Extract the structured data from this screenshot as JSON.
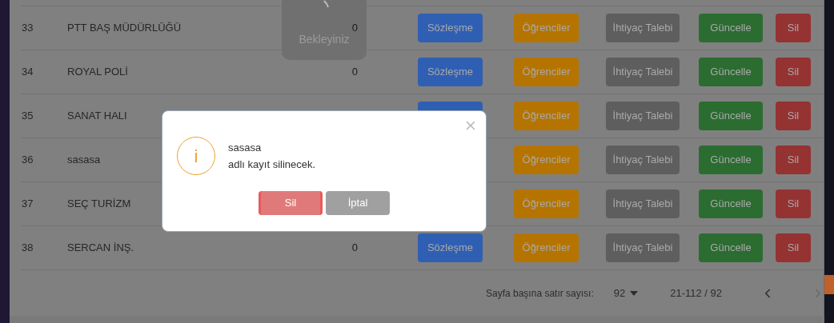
{
  "loader": {
    "text": "Bekleyiniz"
  },
  "table": {
    "rows": [
      {
        "no": "33",
        "name": "PTT BAŞ MÜDÜRLÜĞÜ",
        "count": "0",
        "actions": [
          {
            "kind": "contract",
            "label": "Sözleşme"
          },
          {
            "kind": "students",
            "label": "Öğrenciler"
          },
          {
            "kind": "request",
            "label": "İhtiyaç Talebi"
          },
          {
            "kind": "update",
            "label": "Güncelle"
          },
          {
            "kind": "delete",
            "label": "Sil"
          }
        ]
      },
      {
        "no": "34",
        "name": "ROYAL POLİ",
        "count": "0",
        "actions": [
          {
            "kind": "contract",
            "label": "Sözleşme"
          },
          {
            "kind": "students",
            "label": "Öğrenciler"
          },
          {
            "kind": "request",
            "label": "İhtiyaç Talebi"
          },
          {
            "kind": "update",
            "label": "Güncelle"
          },
          {
            "kind": "delete",
            "label": "Sil"
          }
        ]
      },
      {
        "no": "35",
        "name": "SANAT HALI",
        "actions": [
          {
            "kind": "contract"
          },
          {
            "kind": "students",
            "label": "Öğrenciler"
          },
          {
            "kind": "request",
            "label": "İhtiyaç Talebi"
          },
          {
            "kind": "update",
            "label": "Güncelle"
          },
          {
            "kind": "delete",
            "label": "Sil"
          }
        ]
      },
      {
        "no": "36",
        "name": "sasasa",
        "actions": [
          {
            "kind": "students",
            "label": "Öğrenciler"
          },
          {
            "kind": "request",
            "label": "İhtiyaç Talebi"
          },
          {
            "kind": "update",
            "label": "Güncelle"
          },
          {
            "kind": "delete",
            "label": "Sil"
          }
        ]
      },
      {
        "no": "37",
        "name": "SEÇ TURİZM",
        "actions": [
          {
            "kind": "students",
            "label": "Öğrenciler"
          },
          {
            "kind": "request",
            "label": "İhtiyaç Talebi"
          },
          {
            "kind": "update",
            "label": "Güncelle"
          },
          {
            "kind": "delete",
            "label": "Sil"
          }
        ]
      },
      {
        "no": "38",
        "name": "SERCAN İNŞ.",
        "count": "0",
        "actions": [
          {
            "kind": "contract",
            "label": "Sözleşme"
          },
          {
            "kind": "students",
            "label": "Öğrenciler"
          },
          {
            "kind": "request",
            "label": "İhtiyaç Talebi"
          },
          {
            "kind": "update",
            "label": "Güncelle"
          },
          {
            "kind": "delete",
            "label": "Sil"
          }
        ]
      }
    ]
  },
  "pagination": {
    "rows_per_page_label": "Sayfa başına satır sayısı:",
    "rows_per_page": "92",
    "range": "21-112 / 92",
    "prev_disabled": false,
    "next_disabled": true
  },
  "dialog": {
    "icon_text": "i",
    "record_name": "sasasa",
    "message": "adlı kayıt silinecek.",
    "buttons": [
      {
        "kind": "confirm",
        "label": "Sil"
      },
      {
        "kind": "cancel",
        "label": "İptal"
      }
    ]
  }
}
